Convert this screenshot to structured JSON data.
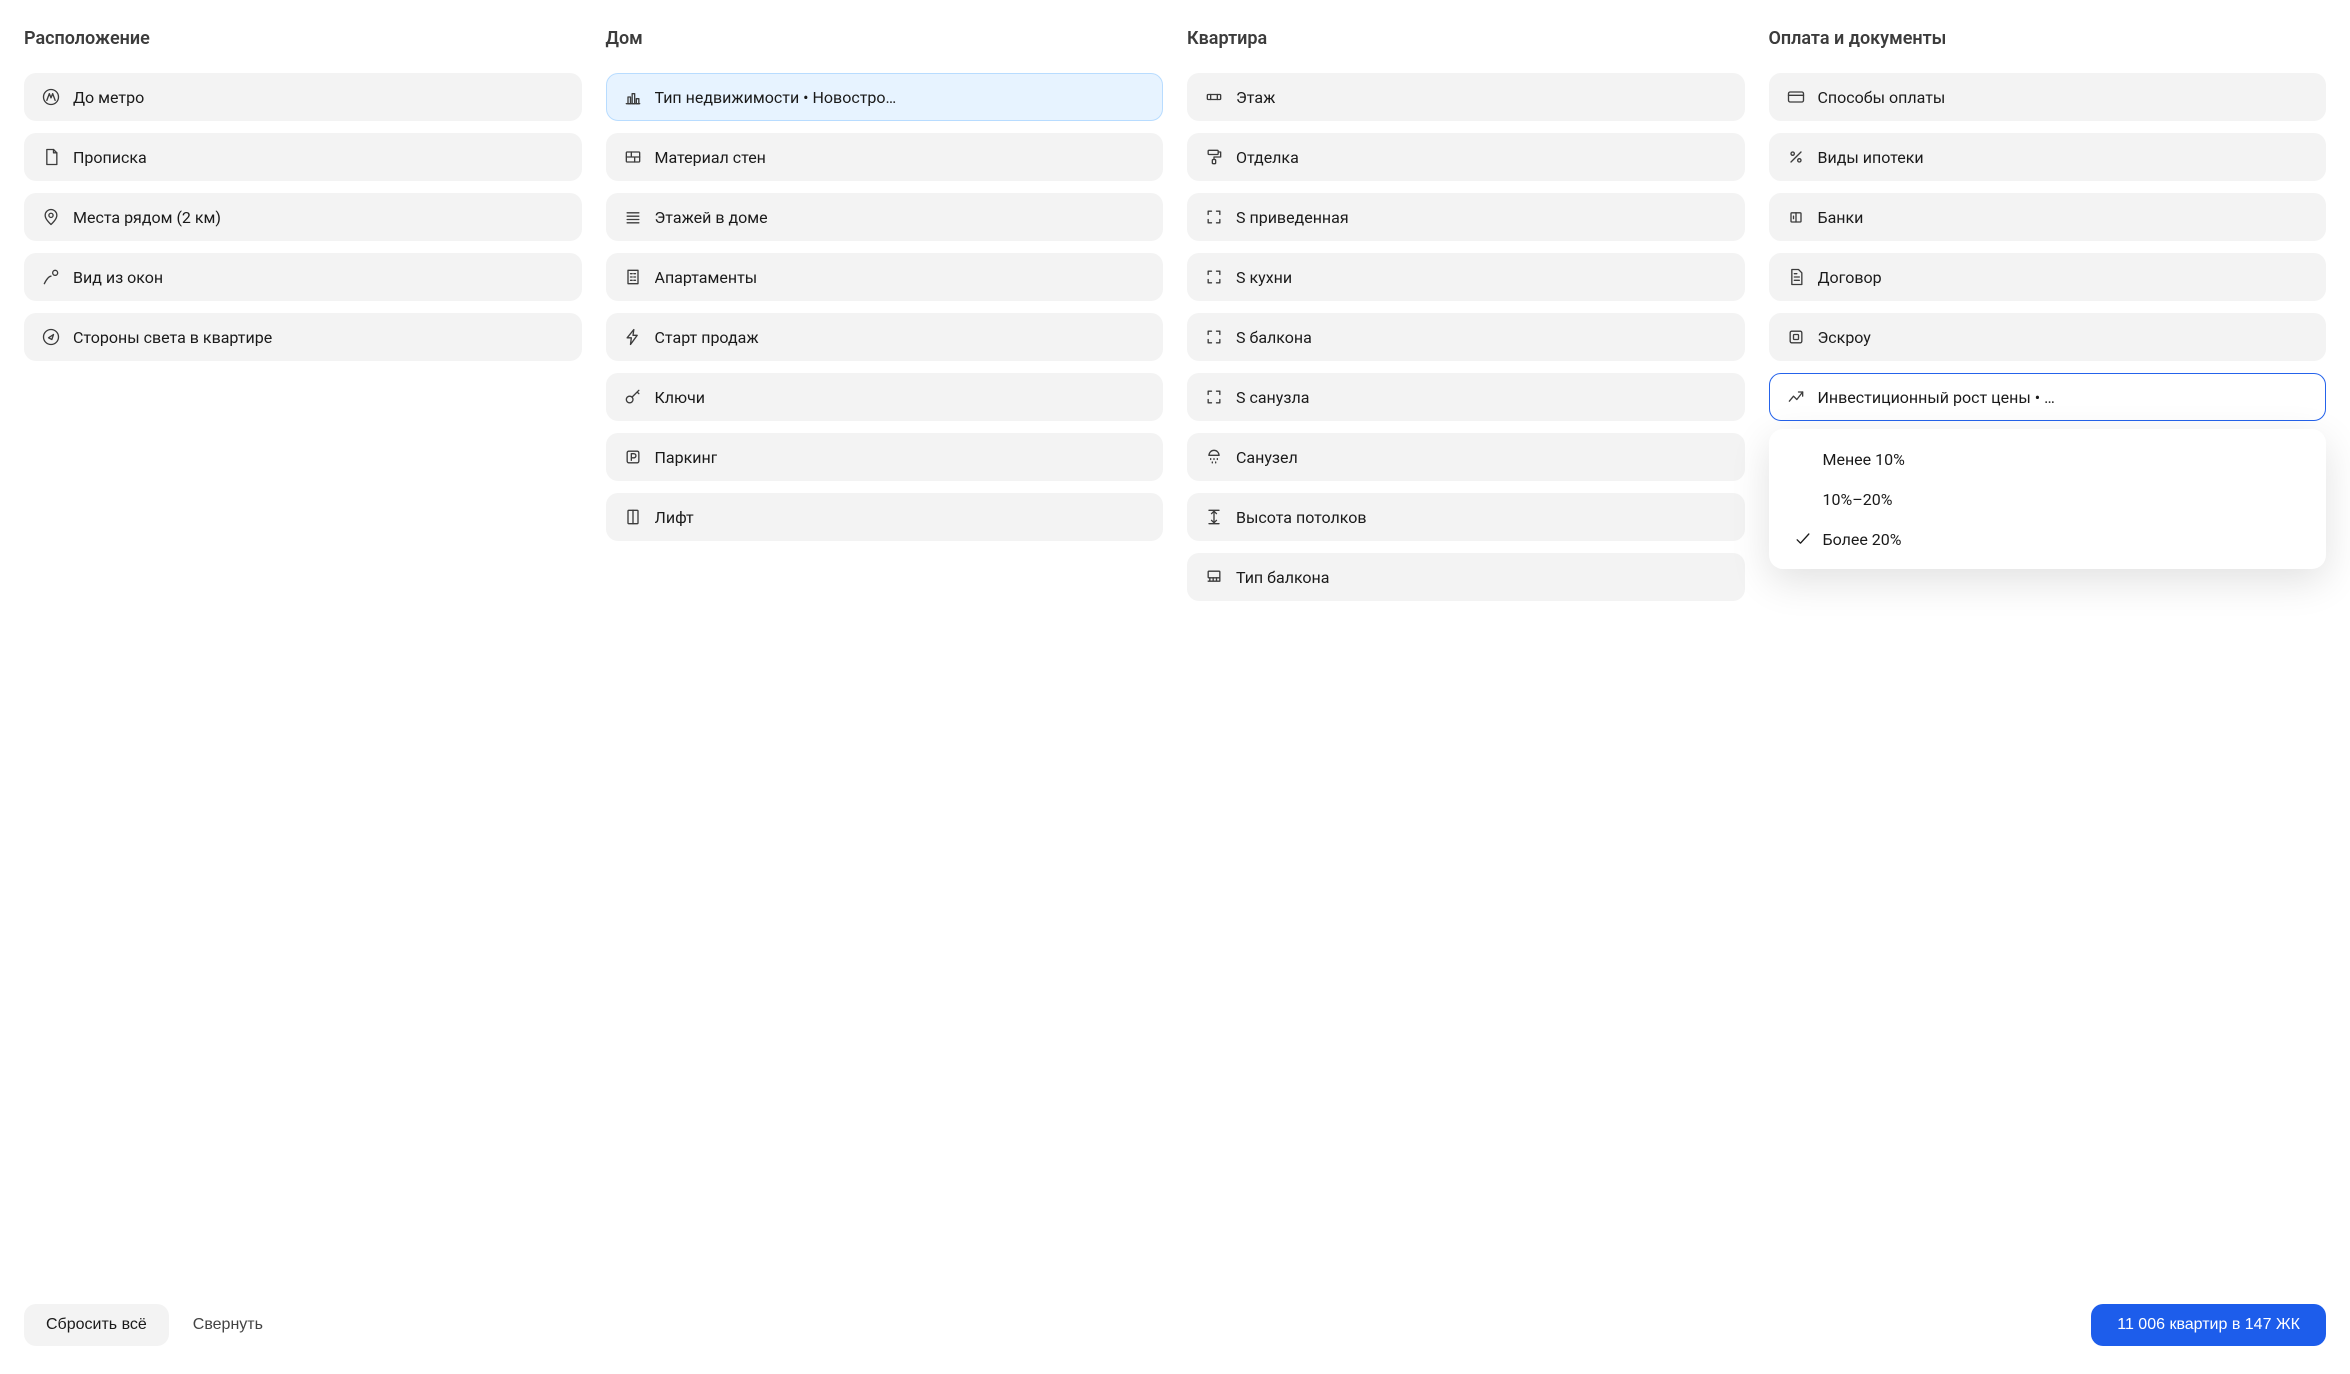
{
  "columns": {
    "location": {
      "title": "Расположение",
      "items": [
        {
          "icon": "metro-icon",
          "label": "До метро"
        },
        {
          "icon": "document-icon",
          "label": "Прописка"
        },
        {
          "icon": "pin-icon",
          "label": "Места рядом (2 км)"
        },
        {
          "icon": "window-view-icon",
          "label": "Вид из окон"
        },
        {
          "icon": "compass-icon",
          "label": "Стороны света в квартире"
        }
      ]
    },
    "house": {
      "title": "Дом",
      "items": [
        {
          "icon": "chart-bars-icon",
          "label": "Тип недвижимости • Новостро…",
          "state": "active-blue-light"
        },
        {
          "icon": "brick-icon",
          "label": "Материал стен"
        },
        {
          "icon": "floors-icon",
          "label": "Этажей в доме"
        },
        {
          "icon": "building-icon",
          "label": "Апартаменты"
        },
        {
          "icon": "lightning-icon",
          "label": "Старт продаж"
        },
        {
          "icon": "key-icon",
          "label": "Ключи"
        },
        {
          "icon": "parking-icon",
          "label": "Паркинг"
        },
        {
          "icon": "elevator-icon",
          "label": "Лифт"
        }
      ]
    },
    "apartment": {
      "title": "Квартира",
      "items": [
        {
          "icon": "floor-icon",
          "label": "Этаж"
        },
        {
          "icon": "paint-roller-icon",
          "label": "Отделка"
        },
        {
          "icon": "area-icon",
          "label": "S приведенная"
        },
        {
          "icon": "area-icon",
          "label": "S кухни"
        },
        {
          "icon": "area-icon",
          "label": "S балкона"
        },
        {
          "icon": "area-icon",
          "label": "S санузла"
        },
        {
          "icon": "shower-icon",
          "label": "Санузел"
        },
        {
          "icon": "ceiling-height-icon",
          "label": "Высота потолков"
        },
        {
          "icon": "balcony-type-icon",
          "label": "Тип балкона"
        }
      ]
    },
    "payment": {
      "title": "Оплата и документы",
      "items": [
        {
          "icon": "card-icon",
          "label": "Способы оплаты"
        },
        {
          "icon": "percent-icon",
          "label": "Виды ипотеки"
        },
        {
          "icon": "bank-icon",
          "label": "Банки"
        },
        {
          "icon": "contract-icon",
          "label": "Договор"
        },
        {
          "icon": "escrow-icon",
          "label": "Эскроу"
        },
        {
          "icon": "growth-icon",
          "label": "Инвестиционный рост цены • …",
          "state": "active-blue-outline",
          "popover": true
        }
      ]
    }
  },
  "popover": {
    "options": [
      {
        "label": "Менее 10%",
        "selected": false
      },
      {
        "label": "10%–20%",
        "selected": false
      },
      {
        "label": "Более 20%",
        "selected": true
      }
    ]
  },
  "footer": {
    "reset": "Сбросить всё",
    "collapse": "Свернуть",
    "results": "11 006 квартир в 147 ЖК"
  }
}
